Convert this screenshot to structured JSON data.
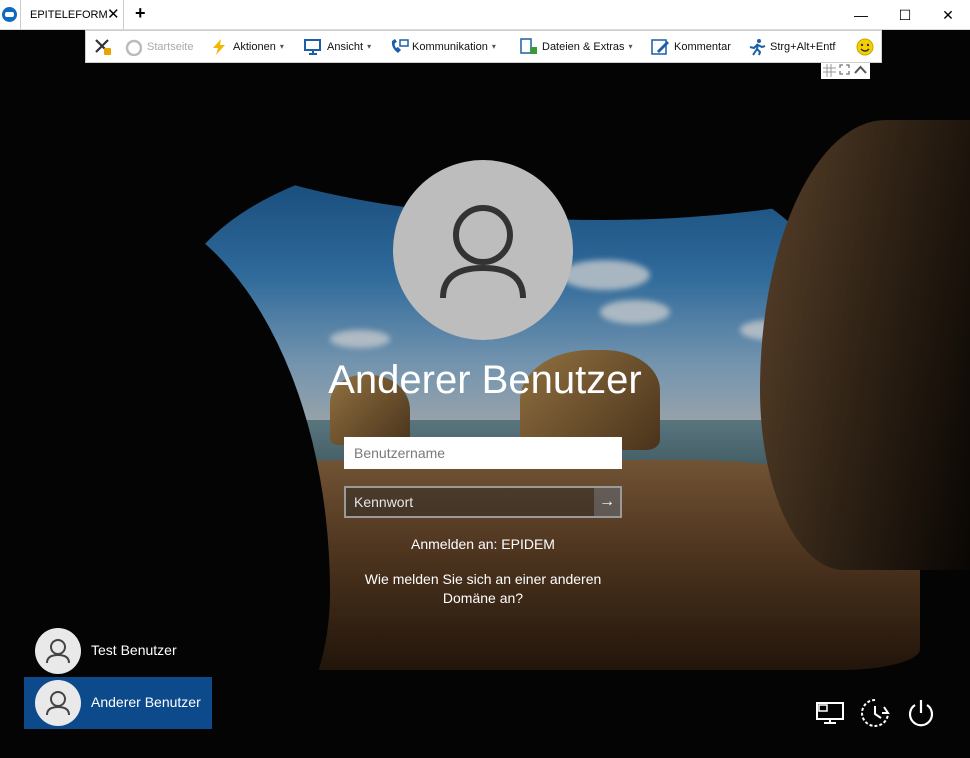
{
  "titlebar": {
    "tab_label": "EPITELEFORM",
    "close_tab": "✕",
    "add_tab": "+",
    "minimize": "—",
    "maximize": "☐",
    "close": "✕"
  },
  "toolbar": {
    "items": [
      {
        "label": "",
        "icon": "disconnect-icon"
      },
      {
        "label": "Startseite",
        "icon": "home-icon",
        "disabled": true
      },
      {
        "label": "Aktionen",
        "icon": "lightning-icon",
        "dropdown": true
      },
      {
        "label": "Ansicht",
        "icon": "monitor-icon",
        "dropdown": true
      },
      {
        "label": "Kommunikation",
        "icon": "phone-icon",
        "dropdown": true
      },
      {
        "label": "Dateien & Extras",
        "icon": "files-icon",
        "dropdown": true
      },
      {
        "label": "Kommentar",
        "icon": "comment-icon"
      },
      {
        "label": "Strg+Alt+Entf",
        "icon": "running-man-icon"
      },
      {
        "label": "",
        "icon": "smiley-icon"
      }
    ],
    "caret": "▾"
  },
  "login": {
    "username": "Anderer Benutzer",
    "username_placeholder": "Benutzername",
    "password_placeholder": "Kennwort",
    "submit_arrow": "→",
    "signin_to": "Anmelden an: EPIDEM",
    "other_domain_line1": "Wie melden Sie sich an einer anderen",
    "other_domain_line2": "Domäne an?"
  },
  "users": [
    {
      "name": "Test Benutzer",
      "selected": false
    },
    {
      "name": "Anderer Benutzer",
      "selected": true
    }
  ],
  "colors": {
    "selected_user": "#0c4a8c",
    "teamviewer_blue": "#0e6ac0",
    "toolbar_icon_blue": "#1c5fa8",
    "lightning": "#f2b705"
  }
}
